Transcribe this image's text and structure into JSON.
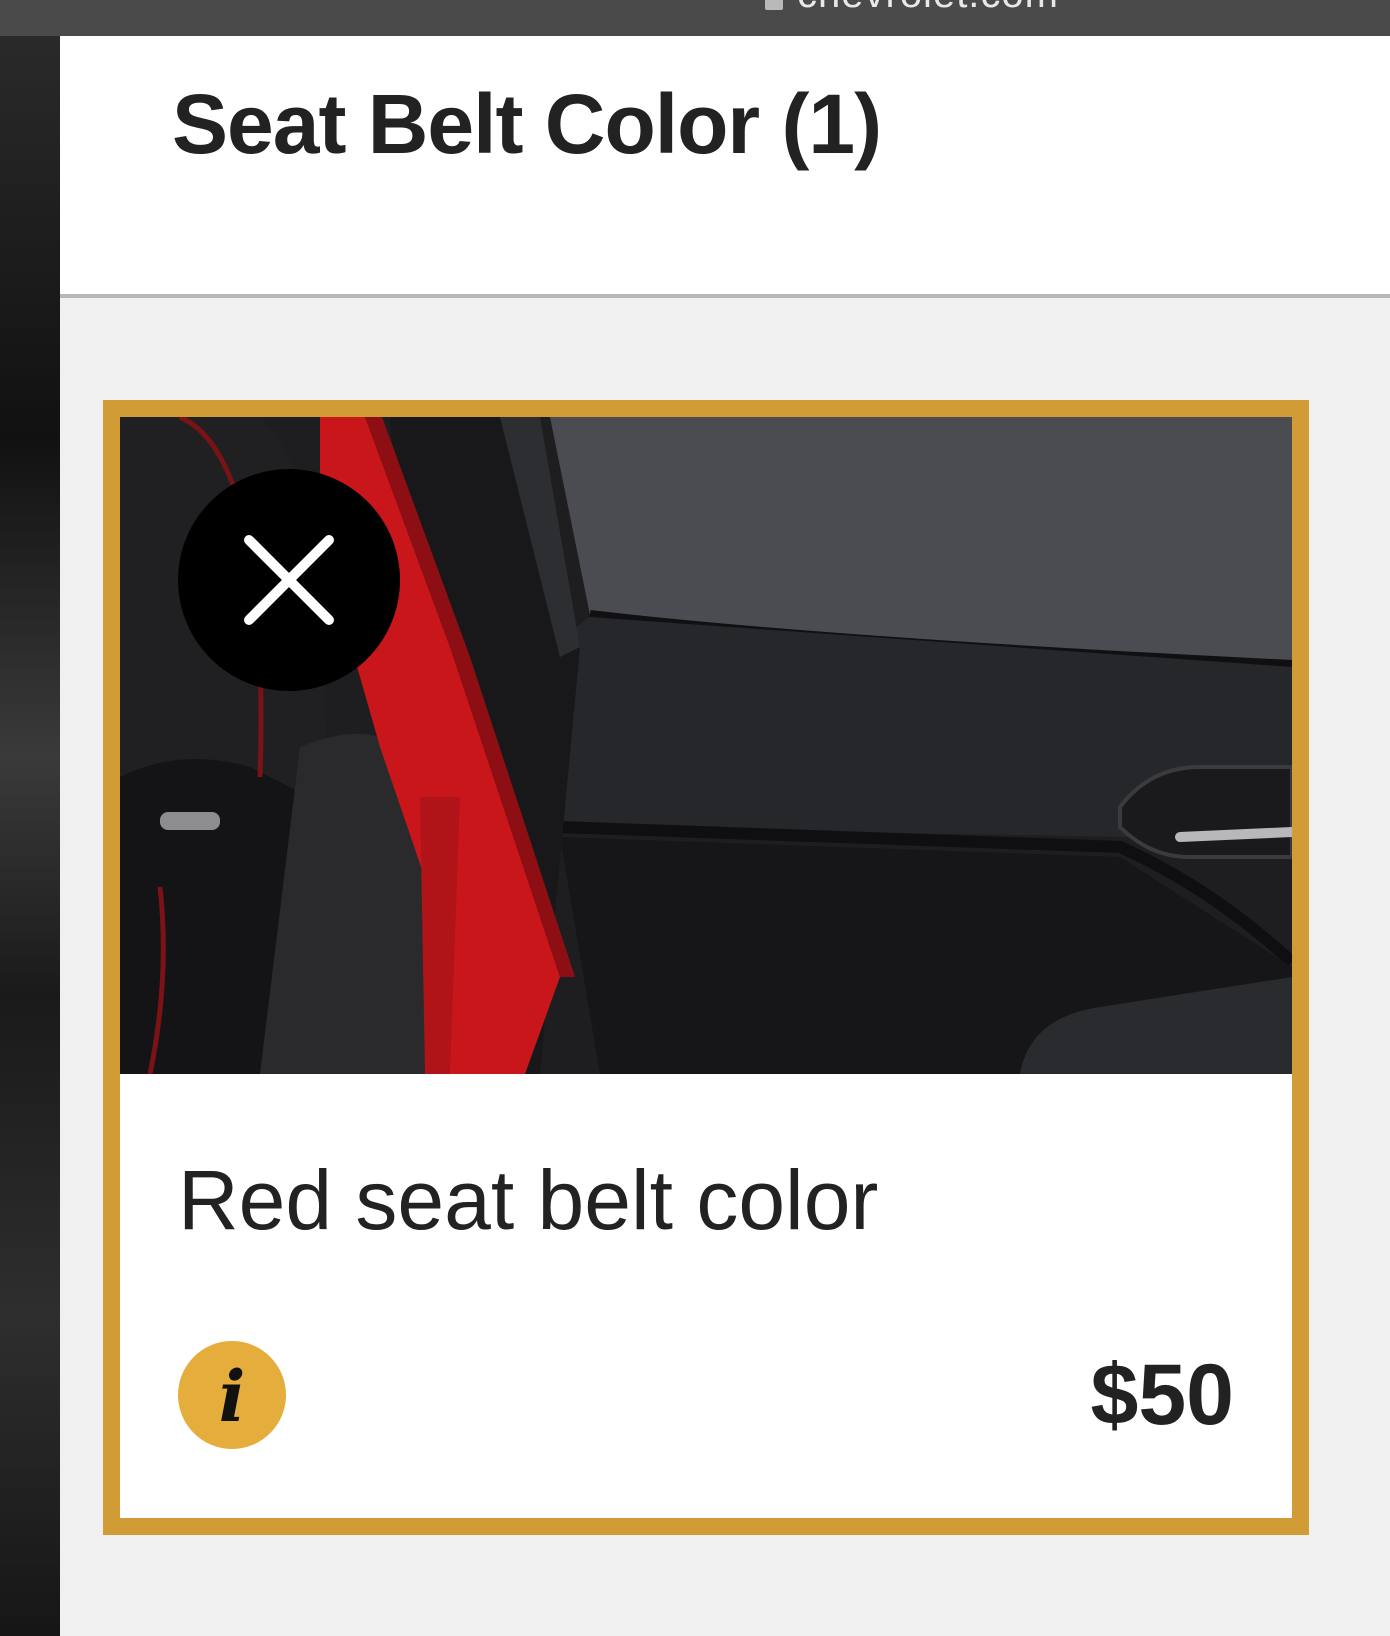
{
  "browser": {
    "url": "chevrolet.com"
  },
  "panel": {
    "title": "Seat Belt Color (1)"
  },
  "option": {
    "name": "Red seat belt color",
    "price": "$50",
    "selected": true,
    "image_icon": "seat-belt-photo",
    "remove_icon": "close-icon",
    "info_icon": "info-icon",
    "info_glyph": "i"
  },
  "colors": {
    "accent": "#d19b35",
    "info": "#e5ad3c",
    "belt": "#c8161b",
    "text": "#222222"
  }
}
